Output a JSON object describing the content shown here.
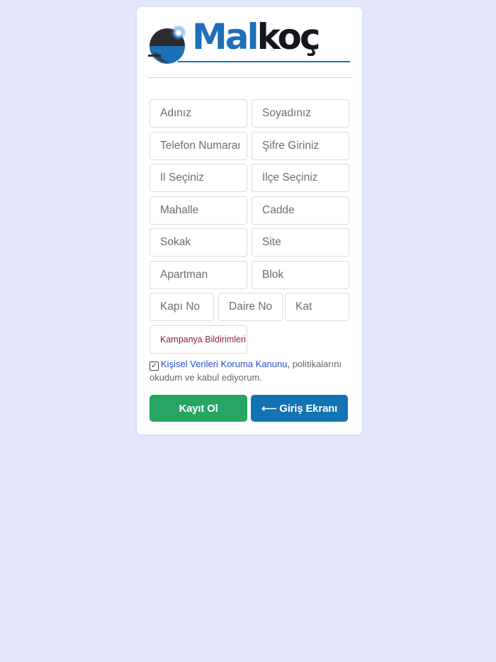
{
  "brand": {
    "logo_part1": "Mal",
    "logo_part2": "koç",
    "primary_color": "#1d6fb8",
    "dark_color": "#15151b"
  },
  "form": {
    "first_name": {
      "placeholder": "Adınız",
      "value": ""
    },
    "last_name": {
      "placeholder": "Soyadınız",
      "value": ""
    },
    "phone": {
      "placeholder": "Telefon Numaranız",
      "value": ""
    },
    "password": {
      "placeholder": "Şifre Giriniz",
      "value": ""
    },
    "city": {
      "placeholder": "İl Seçiniz",
      "value": ""
    },
    "district": {
      "placeholder": "İlçe Seçiniz",
      "value": ""
    },
    "neighborhood": {
      "placeholder": "Mahalle",
      "value": ""
    },
    "avenue": {
      "placeholder": "Cadde",
      "value": ""
    },
    "street": {
      "placeholder": "Sokak",
      "value": ""
    },
    "site": {
      "placeholder": "Site",
      "value": ""
    },
    "apartment": {
      "placeholder": "Apartman",
      "value": ""
    },
    "block": {
      "placeholder": "Blok",
      "value": ""
    },
    "door_no": {
      "placeholder": "Kapı No",
      "value": ""
    },
    "flat_no": {
      "placeholder": "Daire No",
      "value": ""
    },
    "floor": {
      "placeholder": "Kat",
      "value": ""
    },
    "campaign_select": {
      "value": "Kampanya Bildirimleri"
    }
  },
  "consent": {
    "checked": true,
    "check_mark": "✓",
    "link_text": "Kişisel Verileri Koruma Kanunu,",
    "text": " politikalarını okudum ve kabul ediyorum."
  },
  "buttons": {
    "register": "Kayıt Ol",
    "login": "⟵ Giriş Ekranı"
  },
  "colors": {
    "background": "#e3e6fc",
    "register_button": "#26a661",
    "login_button": "#1473b3",
    "link": "#2a4bd1",
    "campaign_text": "#8b1d4f"
  }
}
